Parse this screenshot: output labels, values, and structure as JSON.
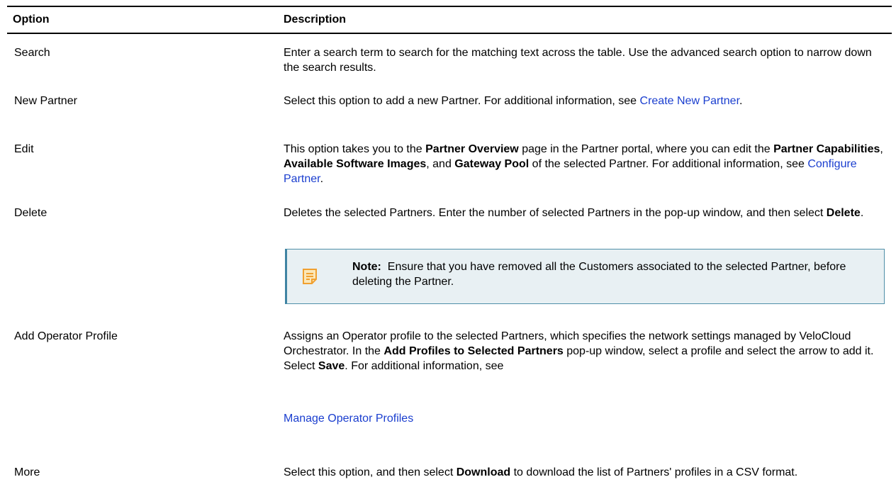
{
  "table": {
    "headers": {
      "option": "Option",
      "description": "Description"
    },
    "rows": [
      {
        "option": "Search",
        "description": "Enter a search term to search for the matching text across the table. Use the advanced search option to narrow down the search results."
      },
      {
        "option": "New Partner",
        "description_before": "Select this option to add a new Partner. For additional information, see ",
        "link": "Create New Partner",
        "description_after": "."
      },
      {
        "option": "Edit",
        "desc_parts": {
          "p1": "This option takes you to the ",
          "b1": "Partner Overview",
          "p2": " page in the Partner portal, where you can edit the ",
          "b2": "Partner Capabilities",
          "p3": ", ",
          "b3": "Available Software Images",
          "p4": ", and ",
          "b4": "Gateway Pool",
          "p5": " of the selected Partner. For additional information, see ",
          "link": "Configure Partner",
          "p6": "."
        }
      },
      {
        "option": "Delete",
        "desc_parts": {
          "p1": "Deletes the selected Partners. Enter the number of selected Partners in the pop-up window, and then select ",
          "b1": "Delete",
          "p2": "."
        },
        "note": {
          "label": "Note:",
          "text": "Ensure that you have removed all the Customers associated to the selected Partner, before deleting the Partner.",
          "icon": "note-icon",
          "icon_color": "#f0a030"
        }
      },
      {
        "option": "Add Operator Profile",
        "desc_parts": {
          "p1": "Assigns an Operator profile to the selected Partners, which specifies the network settings managed by VeloCloud Orchestrator. In the ",
          "b1": "Add Profiles to Selected Partners",
          "p2": " pop-up window, select a profile and select the arrow to add it. Select ",
          "b2": "Save",
          "p3": ". For additional information, see"
        },
        "link": "Manage Operator Profiles"
      },
      {
        "option": "More",
        "desc_parts": {
          "p1": "Select this option, and then select ",
          "b1": "Download",
          "p2": " to download the list of Partners' profiles in a CSV format."
        }
      }
    ]
  },
  "colors": {
    "link": "#1a3ecf",
    "note_bg": "#e8f0f3",
    "note_border": "#3f84a3"
  }
}
